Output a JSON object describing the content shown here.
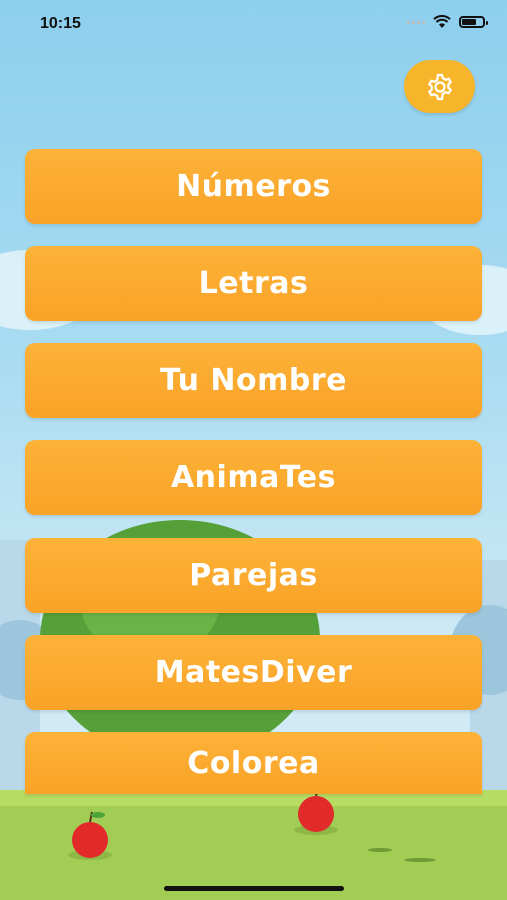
{
  "status_bar": {
    "time": "10:15",
    "battery_level": 0.7
  },
  "settings": {
    "icon": "gear-icon",
    "color": "#f7b52c"
  },
  "menu": {
    "items": [
      {
        "label": "Números"
      },
      {
        "label": "Letras"
      },
      {
        "label": "Tu Nombre"
      },
      {
        "label": "AnimaTes"
      },
      {
        "label": "Parejas"
      },
      {
        "label": "MatesDiver"
      },
      {
        "label": "Colorea"
      }
    ],
    "button_color": "#fba72e",
    "text_color": "#ffffff"
  },
  "colors": {
    "sky": "#8ecfee",
    "grass": "#a2cd54",
    "tree": "#56a03a",
    "apple": "#e22a2a"
  }
}
